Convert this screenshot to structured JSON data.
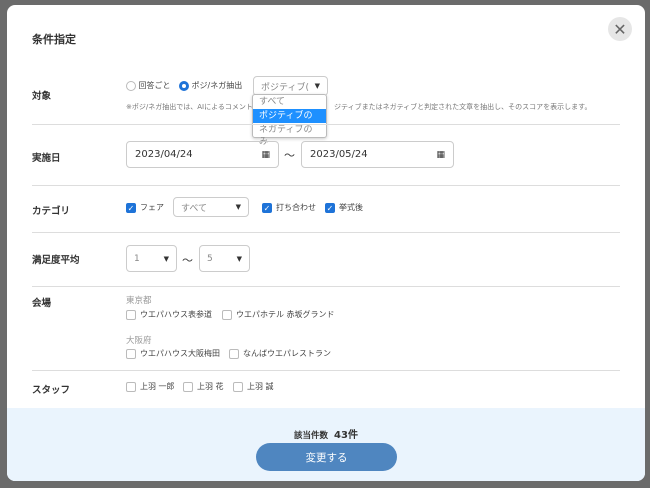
{
  "modal": {
    "title": "条件指定",
    "close_icon": "close-icon"
  },
  "target": {
    "label": "対象",
    "radio1": "回答ごと",
    "radio2": "ポジ/ネガ抽出",
    "select_value": "ポジティブ(",
    "note_a": "※ポジ/ネガ抽出では、AIによるコメント",
    "note_b": "ジティブまたはネガティブと判定された文章を抽出し、そのスコアを表示します。",
    "options": [
      "すべて",
      "ポジティブのみ",
      "ネガティブのみ"
    ],
    "highlighted": "ポジティブのみ"
  },
  "date": {
    "label": "実施日",
    "from": "2023/04/24",
    "tilde": "〜",
    "to": "2023/05/24"
  },
  "category": {
    "label": "カテゴリ",
    "fair": "フェア",
    "fair_select": "すべて",
    "meeting": "打ち合わせ",
    "after": "挙式後"
  },
  "satisfaction": {
    "label": "満足度平均",
    "min": "1",
    "tilde": "〜",
    "max": "5"
  },
  "venue": {
    "label": "会場",
    "groups": [
      {
        "name": "東京都",
        "items": [
          "ウエパハウス表参道",
          "ウエパホテル 赤坂グランド"
        ]
      },
      {
        "name": "大阪府",
        "items": [
          "ウエパハウス大阪梅田",
          "なんばウエパレストラン"
        ]
      }
    ]
  },
  "staff": {
    "label": "スタッフ",
    "items": [
      "上羽 一郎",
      "上羽 花",
      "上羽 誠"
    ]
  },
  "footer": {
    "count_label": "該当件数",
    "count_value": "43件",
    "submit": "変更する"
  },
  "colors": {
    "accent": "#1e73d8",
    "button": "#4f86c0",
    "footer_bg": "#eaf4fd"
  }
}
